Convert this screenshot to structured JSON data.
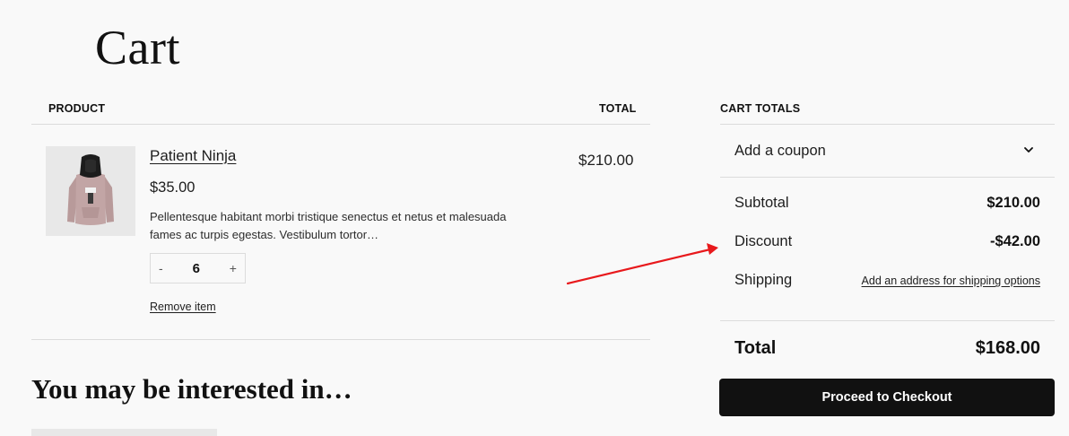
{
  "page": {
    "title": "Cart"
  },
  "table": {
    "product_header": "PRODUCT",
    "total_header": "TOTAL"
  },
  "item": {
    "name": "Patient Ninja",
    "price": "$35.00",
    "description": "Pellentesque habitant morbi tristique senectus et netus et malesuada fames ac turpis egestas. Vestibulum tortor…",
    "quantity": "6",
    "decrement": "-",
    "increment": "+",
    "remove_label": "Remove item",
    "line_total": "$210.00"
  },
  "recommendations": {
    "heading": "You may be interested in…"
  },
  "totals": {
    "heading": "CART TOTALS",
    "coupon_label": "Add a coupon",
    "subtotal_label": "Subtotal",
    "subtotal_value": "$210.00",
    "discount_label": "Discount",
    "discount_value": "-$42.00",
    "shipping_label": "Shipping",
    "shipping_link": "Add an address for shipping options",
    "total_label": "Total",
    "total_value": "$168.00",
    "checkout_label": "Proceed to Checkout"
  },
  "colors": {
    "background": "#f9f9f9",
    "button": "#111111",
    "annotation_arrow": "#e8191c"
  }
}
